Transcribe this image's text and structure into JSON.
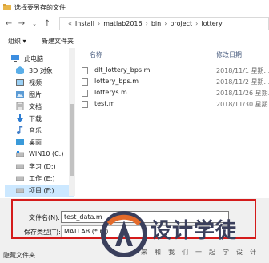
{
  "window": {
    "title": "选择要另存的文件"
  },
  "address": {
    "crumbs": [
      "Install",
      "matlab2016",
      "bin",
      "project",
      "lottery"
    ]
  },
  "toolbar": {
    "organize": "组织 ▾",
    "new_folder": "新建文件夹"
  },
  "nav": {
    "items": [
      {
        "label": "此电脑",
        "icon": "computer-icon"
      },
      {
        "label": "3D 对象",
        "icon": "cube-icon"
      },
      {
        "label": "视频",
        "icon": "video-icon"
      },
      {
        "label": "图片",
        "icon": "picture-icon"
      },
      {
        "label": "文档",
        "icon": "document-icon"
      },
      {
        "label": "下载",
        "icon": "download-icon"
      },
      {
        "label": "音乐",
        "icon": "music-icon"
      },
      {
        "label": "桌面",
        "icon": "desktop-icon"
      },
      {
        "label": "WIN10 (C:)",
        "icon": "drive-icon"
      },
      {
        "label": "学习 (D:)",
        "icon": "drive-icon"
      },
      {
        "label": "工作 (E:)",
        "icon": "drive-icon"
      },
      {
        "label": "项目 (F:)",
        "icon": "drive-icon"
      }
    ]
  },
  "files": {
    "col_name": "名称",
    "col_date": "修改日期",
    "rows": [
      {
        "name": "dlt_lottery_bps.m",
        "date": "2018/11/1 星期..."
      },
      {
        "name": "lottery_bps.m",
        "date": "2018/11/2 星期..."
      },
      {
        "name": "lotterys.m",
        "date": "2018/11/26 星期..."
      },
      {
        "name": "test.m",
        "date": "2018/11/30 星期..."
      }
    ]
  },
  "form": {
    "filename_label": "文件名(N):",
    "filename_value": "test_data.m",
    "filetype_label": "保存类型(T):",
    "filetype_value": "MATLAB (*.m)"
  },
  "footer": {
    "hide_folders": "隐藏文件夹"
  },
  "watermark": {
    "text": "设计学徒",
    "sub": "来和我们一起学设计"
  },
  "colors": {
    "accent": "#cce8ff",
    "highlight": "#d41b1b",
    "watermark": "#3a3f5c"
  }
}
